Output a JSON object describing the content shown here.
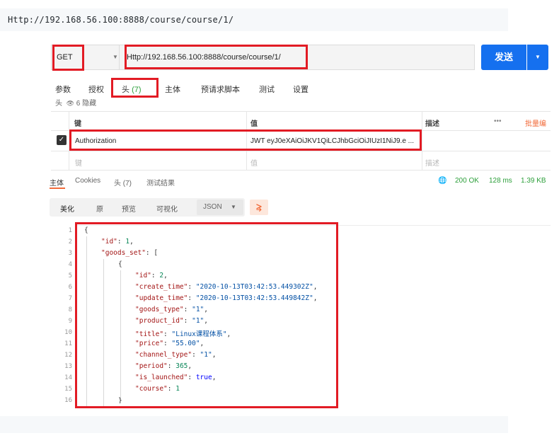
{
  "code_header": {
    "url": "Http://192.168.56.100:8888/course/course/1/"
  },
  "request": {
    "method": "GET",
    "url": "Http://192.168.56.100:8888/course/course/1/",
    "send_label": "发送",
    "send_dropdown": "▼",
    "method_caret": "▼"
  },
  "request_tabs": [
    {
      "label": "参数"
    },
    {
      "label": "授权"
    },
    {
      "label": "头",
      "count": "(7)"
    },
    {
      "label": "主体"
    },
    {
      "label": "预请求脚本"
    },
    {
      "label": "测试"
    },
    {
      "label": "设置"
    }
  ],
  "hidden_headers": {
    "prefix": "头",
    "eye": "👁",
    "text": "6 隐藏"
  },
  "headers_table": {
    "columns": {
      "key": "键",
      "value": "值",
      "desc": "描述",
      "more": "•••",
      "bulk": "批量编"
    },
    "rows": [
      {
        "key": "Authorization",
        "value": "JWT eyJ0eXAiOiJKV1QiLCJhbGciOiJIUzI1NiJ9.e ..."
      }
    ],
    "placeholder": {
      "key": "键",
      "value": "值",
      "desc": "描述"
    }
  },
  "response_tabs": [
    {
      "label": "主体"
    },
    {
      "label": "Cookies"
    },
    {
      "label": "头",
      "count": "(7)"
    },
    {
      "label": "测试结果"
    }
  ],
  "response_status": {
    "globe": "🌐",
    "status": "200 OK",
    "time": "128 ms",
    "size": "1.39 KB"
  },
  "format_bar": {
    "buttons": [
      "美化",
      "原",
      "预览",
      "可视化"
    ],
    "format": "JSON",
    "caret": "▼",
    "wrap_icon": "⥸"
  },
  "code_lines": [
    {
      "no": "1"
    },
    {
      "no": "2"
    },
    {
      "no": "3"
    },
    {
      "no": "4"
    },
    {
      "no": "5"
    },
    {
      "no": "6"
    },
    {
      "no": "7"
    },
    {
      "no": "8"
    },
    {
      "no": "9"
    },
    {
      "no": "10"
    },
    {
      "no": "11"
    },
    {
      "no": "12"
    },
    {
      "no": "13"
    },
    {
      "no": "14"
    },
    {
      "no": "15"
    },
    {
      "no": "16"
    }
  ],
  "json": {
    "open": "{",
    "id_key": "\"id\"",
    "id_val": "1",
    "goods_key": "\"goods_set\"",
    "goods_open": "[",
    "obj_open": "{",
    "g_id_key": "\"id\"",
    "g_id_val": "2",
    "create_key": "\"create_time\"",
    "create_val": "\"2020-10-13T03:42:53.449302Z\"",
    "update_key": "\"update_time\"",
    "update_val": "\"2020-10-13T03:42:53.449842Z\"",
    "gtype_key": "\"goods_type\"",
    "gtype_val": "\"1\"",
    "pid_key": "\"product_id\"",
    "pid_val": "\"1\"",
    "title_key": "\"title\"",
    "title_val": "\"Linux课程体系\"",
    "price_key": "\"price\"",
    "price_val": "\"55.00\"",
    "ctype_key": "\"channel_type\"",
    "ctype_val": "\"1\"",
    "period_key": "\"period\"",
    "period_val": "365",
    "launched_key": "\"is_launched\"",
    "launched_val": "true",
    "course_key": "\"course\"",
    "course_val": "1",
    "obj_close": "}"
  },
  "highlight_color": "#e21b24",
  "accent_color": "#1570ef"
}
